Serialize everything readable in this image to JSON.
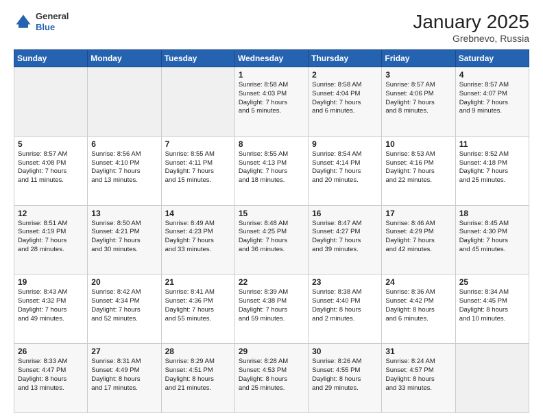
{
  "header": {
    "logo_line1": "General",
    "logo_line2": "Blue",
    "month_title": "January 2025",
    "location": "Grebnevo, Russia"
  },
  "days_of_week": [
    "Sunday",
    "Monday",
    "Tuesday",
    "Wednesday",
    "Thursday",
    "Friday",
    "Saturday"
  ],
  "weeks": [
    [
      {
        "num": "",
        "info": ""
      },
      {
        "num": "",
        "info": ""
      },
      {
        "num": "",
        "info": ""
      },
      {
        "num": "1",
        "info": "Sunrise: 8:58 AM\nSunset: 4:03 PM\nDaylight: 7 hours\nand 5 minutes."
      },
      {
        "num": "2",
        "info": "Sunrise: 8:58 AM\nSunset: 4:04 PM\nDaylight: 7 hours\nand 6 minutes."
      },
      {
        "num": "3",
        "info": "Sunrise: 8:57 AM\nSunset: 4:06 PM\nDaylight: 7 hours\nand 8 minutes."
      },
      {
        "num": "4",
        "info": "Sunrise: 8:57 AM\nSunset: 4:07 PM\nDaylight: 7 hours\nand 9 minutes."
      }
    ],
    [
      {
        "num": "5",
        "info": "Sunrise: 8:57 AM\nSunset: 4:08 PM\nDaylight: 7 hours\nand 11 minutes."
      },
      {
        "num": "6",
        "info": "Sunrise: 8:56 AM\nSunset: 4:10 PM\nDaylight: 7 hours\nand 13 minutes."
      },
      {
        "num": "7",
        "info": "Sunrise: 8:55 AM\nSunset: 4:11 PM\nDaylight: 7 hours\nand 15 minutes."
      },
      {
        "num": "8",
        "info": "Sunrise: 8:55 AM\nSunset: 4:13 PM\nDaylight: 7 hours\nand 18 minutes."
      },
      {
        "num": "9",
        "info": "Sunrise: 8:54 AM\nSunset: 4:14 PM\nDaylight: 7 hours\nand 20 minutes."
      },
      {
        "num": "10",
        "info": "Sunrise: 8:53 AM\nSunset: 4:16 PM\nDaylight: 7 hours\nand 22 minutes."
      },
      {
        "num": "11",
        "info": "Sunrise: 8:52 AM\nSunset: 4:18 PM\nDaylight: 7 hours\nand 25 minutes."
      }
    ],
    [
      {
        "num": "12",
        "info": "Sunrise: 8:51 AM\nSunset: 4:19 PM\nDaylight: 7 hours\nand 28 minutes."
      },
      {
        "num": "13",
        "info": "Sunrise: 8:50 AM\nSunset: 4:21 PM\nDaylight: 7 hours\nand 30 minutes."
      },
      {
        "num": "14",
        "info": "Sunrise: 8:49 AM\nSunset: 4:23 PM\nDaylight: 7 hours\nand 33 minutes."
      },
      {
        "num": "15",
        "info": "Sunrise: 8:48 AM\nSunset: 4:25 PM\nDaylight: 7 hours\nand 36 minutes."
      },
      {
        "num": "16",
        "info": "Sunrise: 8:47 AM\nSunset: 4:27 PM\nDaylight: 7 hours\nand 39 minutes."
      },
      {
        "num": "17",
        "info": "Sunrise: 8:46 AM\nSunset: 4:29 PM\nDaylight: 7 hours\nand 42 minutes."
      },
      {
        "num": "18",
        "info": "Sunrise: 8:45 AM\nSunset: 4:30 PM\nDaylight: 7 hours\nand 45 minutes."
      }
    ],
    [
      {
        "num": "19",
        "info": "Sunrise: 8:43 AM\nSunset: 4:32 PM\nDaylight: 7 hours\nand 49 minutes."
      },
      {
        "num": "20",
        "info": "Sunrise: 8:42 AM\nSunset: 4:34 PM\nDaylight: 7 hours\nand 52 minutes."
      },
      {
        "num": "21",
        "info": "Sunrise: 8:41 AM\nSunset: 4:36 PM\nDaylight: 7 hours\nand 55 minutes."
      },
      {
        "num": "22",
        "info": "Sunrise: 8:39 AM\nSunset: 4:38 PM\nDaylight: 7 hours\nand 59 minutes."
      },
      {
        "num": "23",
        "info": "Sunrise: 8:38 AM\nSunset: 4:40 PM\nDaylight: 8 hours\nand 2 minutes."
      },
      {
        "num": "24",
        "info": "Sunrise: 8:36 AM\nSunset: 4:42 PM\nDaylight: 8 hours\nand 6 minutes."
      },
      {
        "num": "25",
        "info": "Sunrise: 8:34 AM\nSunset: 4:45 PM\nDaylight: 8 hours\nand 10 minutes."
      }
    ],
    [
      {
        "num": "26",
        "info": "Sunrise: 8:33 AM\nSunset: 4:47 PM\nDaylight: 8 hours\nand 13 minutes."
      },
      {
        "num": "27",
        "info": "Sunrise: 8:31 AM\nSunset: 4:49 PM\nDaylight: 8 hours\nand 17 minutes."
      },
      {
        "num": "28",
        "info": "Sunrise: 8:29 AM\nSunset: 4:51 PM\nDaylight: 8 hours\nand 21 minutes."
      },
      {
        "num": "29",
        "info": "Sunrise: 8:28 AM\nSunset: 4:53 PM\nDaylight: 8 hours\nand 25 minutes."
      },
      {
        "num": "30",
        "info": "Sunrise: 8:26 AM\nSunset: 4:55 PM\nDaylight: 8 hours\nand 29 minutes."
      },
      {
        "num": "31",
        "info": "Sunrise: 8:24 AM\nSunset: 4:57 PM\nDaylight: 8 hours\nand 33 minutes."
      },
      {
        "num": "",
        "info": ""
      }
    ]
  ]
}
